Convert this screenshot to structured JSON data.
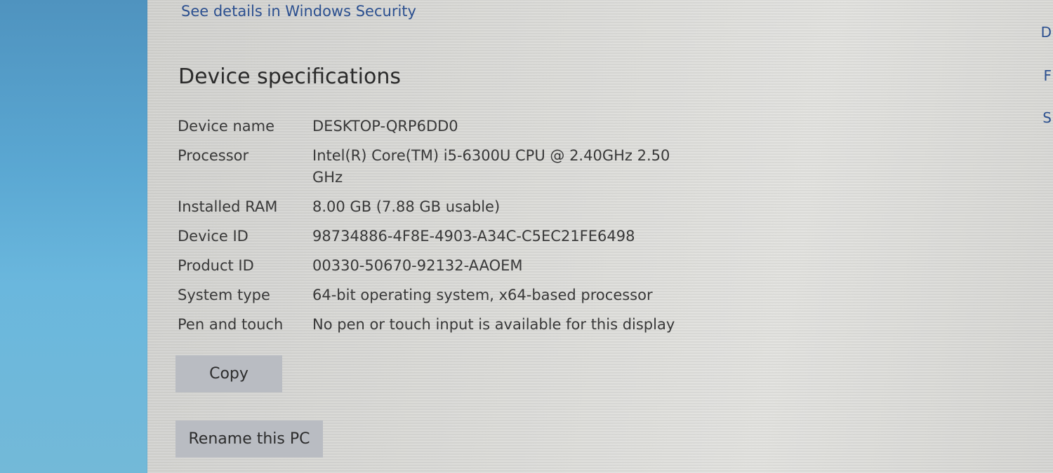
{
  "window": {
    "security_link": "See details in Windows Security",
    "section_title": "Device specifications",
    "edge_letters": [
      "D",
      "F",
      "S"
    ]
  },
  "specs": [
    {
      "label": "Device name",
      "value": "DESKTOP-QRP6DD0"
    },
    {
      "label": "Processor",
      "value": "Intel(R) Core(TM) i5-6300U CPU @ 2.40GHz   2.50 GHz"
    },
    {
      "label": "Installed RAM",
      "value": "8.00 GB (7.88 GB usable)"
    },
    {
      "label": "Device ID",
      "value": "98734886-4F8E-4903-A34C-C5EC21FE6498"
    },
    {
      "label": "Product ID",
      "value": "00330-50670-92132-AAOEM"
    },
    {
      "label": "System type",
      "value": "64-bit operating system, x64-based processor"
    },
    {
      "label": "Pen and touch",
      "value": "No pen or touch input is available for this display"
    }
  ],
  "buttons": {
    "copy": "Copy",
    "rename": "Rename this PC"
  }
}
